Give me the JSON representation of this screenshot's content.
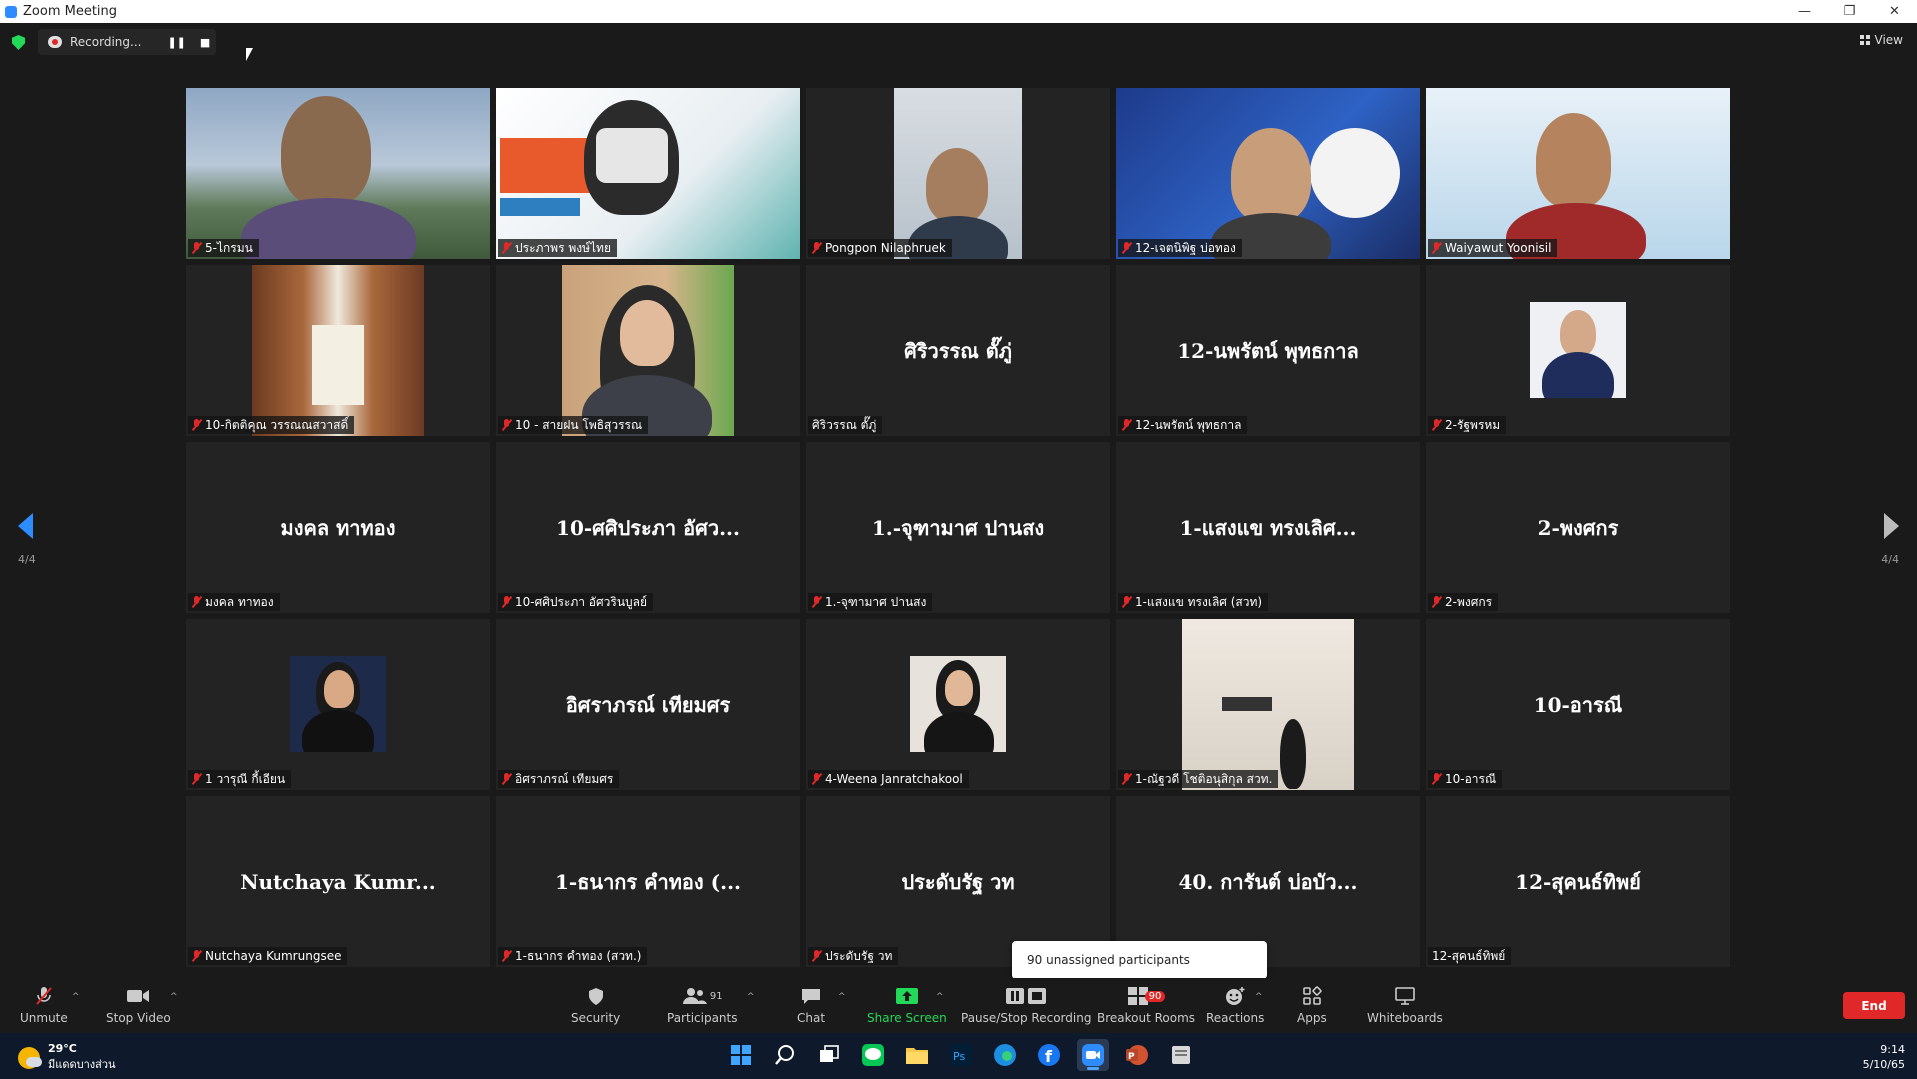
{
  "window": {
    "title": "Zoom Meeting",
    "minimize": "—",
    "restore": "❐",
    "close": "✕"
  },
  "meeting": {
    "recording_label": "Recording...",
    "pause_glyph": "❚❚",
    "stop_glyph": "■",
    "view_label": "View",
    "page_left": "4/4",
    "page_right": "4/4"
  },
  "tiles": [
    {
      "label": "5-ไกรมน"
    },
    {
      "label": "ประภาพร พงษ์ไทย"
    },
    {
      "label": "Pongpon Nilaphruek"
    },
    {
      "label": "12-เจตนิพิฐ บ่อทอง"
    },
    {
      "label": "Waiyawut Yoonisil"
    },
    {
      "label": "10-กิตติคุณ วรรณณสวาสดิ์"
    },
    {
      "label": "10 - สายฝน โพธิสุวรรณ"
    },
    {
      "name": "ศิริวรรณ ตั๊ภู่",
      "label": "ศิริวรรณ ตั๊ภู่"
    },
    {
      "name": "12-นพรัตน์ พุทธกาล",
      "label": "12-นพรัตน์ พุทธกาล"
    },
    {
      "label": "2-รัฐพรหม"
    },
    {
      "name": "มงคล ทาทอง",
      "label": "มงคล ทาทอง"
    },
    {
      "name": "10-ศศิประภา อัศว...",
      "label": "10-ศศิประภา อัศวรินบูลย์"
    },
    {
      "name": "1.-จุฑามาศ ปานสง",
      "label": "1.-จุฑามาศ ปานสง"
    },
    {
      "name": "1-แสงแข ทรงเลิศ...",
      "label": "1-แสงแข ทรงเลิศ (สวท)"
    },
    {
      "name": "2-พงศกร",
      "label": "2-พงศกร"
    },
    {
      "label": "1 วารุณี กี้เอียน"
    },
    {
      "name": "อิศราภรณ์ เทียมศร",
      "label": "อิศราภรณ์ เทียมศร"
    },
    {
      "label": "4-Weena Janratchakool"
    },
    {
      "label": "1-ณัฐวดี โชติอนุสิกุล สวท."
    },
    {
      "name": "10-อารณี",
      "label": "10-อารณี"
    },
    {
      "name": "Nutchaya Kumr...",
      "label": "Nutchaya Kumrungsee"
    },
    {
      "name": "1-ธนากร คำทอง (...",
      "label": "1-ธนากร คำทอง (สวท.)"
    },
    {
      "name": "ประดับรัฐ วท",
      "label": "ประดับรัฐ วท"
    },
    {
      "name": "40. การันต์ บ่อบัว...",
      "label": ""
    },
    {
      "name": "12-สุคนธ์ทิพย์",
      "label": "12-สุคนธ์ทิพย์"
    }
  ],
  "tooltip": "90 unassigned participants",
  "toolbar": {
    "unmute": "Unmute",
    "stop_video": "Stop Video",
    "security": "Security",
    "participants": "Participants",
    "participants_count": "91",
    "chat": "Chat",
    "share_screen": "Share Screen",
    "pause_stop_recording": "Pause/Stop Recording",
    "breakout_rooms": "Breakout Rooms",
    "breakout_count": "90",
    "reactions": "Reactions",
    "apps": "Apps",
    "whiteboards": "Whiteboards",
    "end": "End"
  },
  "taskbar": {
    "temperature": "29°C",
    "weather_desc": "มีแดดบางส่วน",
    "time": "9:14",
    "date": "5/10/65",
    "apps": [
      "windows-start-icon",
      "search-icon",
      "task-view-icon",
      "line-icon",
      "file-explorer-icon",
      "photoshop-icon",
      "edge-icon",
      "facebook-icon",
      "zoom-icon",
      "powerpoint-icon",
      "files-icon"
    ]
  },
  "colors": {
    "accent": "#2d8cff",
    "muted_red": "#e02828",
    "share_green": "#23d959",
    "tile_bg": "#232323"
  }
}
